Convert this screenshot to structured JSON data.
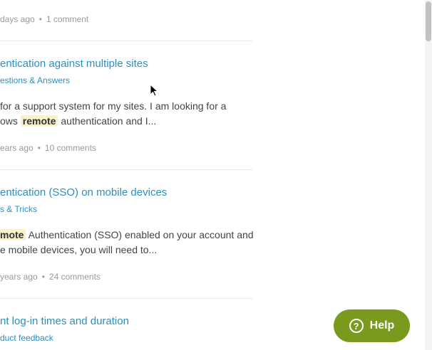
{
  "results": [
    {
      "meta_time": "days ago",
      "meta_comments": "1 comment"
    },
    {
      "title": "entication against multiple sites",
      "category": "estions & Answers",
      "snippet_line1": " for a support system for my sites. I am looking for a",
      "snippet_line2_pre": "ows ",
      "snippet_highlight": "remote",
      "snippet_line2_post": " authentication and I...",
      "meta_time": "ears ago",
      "meta_comments": "10 comments"
    },
    {
      "title": "entication (SSO) on mobile devices",
      "category": "s & Tricks",
      "snippet_highlight": "mote",
      "snippet_line1_post": " Authentication (SSO) enabled on your account and",
      "snippet_line2": "e mobile devices, you will need to...",
      "meta_time": "years ago",
      "meta_comments": "24 comments"
    },
    {
      "title": "nt log-in times and duration",
      "category": "duct feedback"
    }
  ],
  "help_button": {
    "icon": "question-circle-icon",
    "label": "Help"
  },
  "colors": {
    "link": "#2a8fc0",
    "highlight": "#fbf1c9",
    "help_bg": "#7a9a1e"
  }
}
